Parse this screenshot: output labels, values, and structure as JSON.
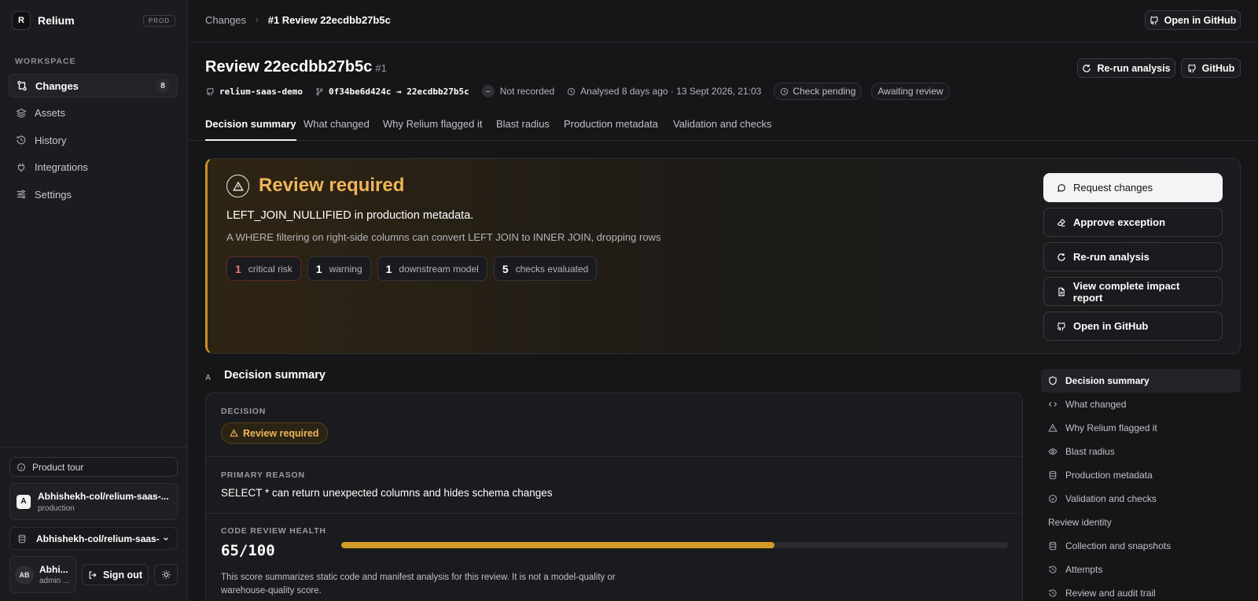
{
  "sidebar": {
    "brand": {
      "logo": "R",
      "name": "Relium",
      "env": "PROD"
    },
    "section_label": "WORKSPACE",
    "nav": [
      {
        "label": "Changes",
        "count": "8",
        "icon": "git-compare-icon"
      },
      {
        "label": "Assets",
        "icon": "layers-icon"
      },
      {
        "label": "History",
        "icon": "history-icon"
      },
      {
        "label": "Integrations",
        "icon": "plug-icon"
      },
      {
        "label": "Settings",
        "icon": "sliders-icon"
      }
    ],
    "product_tour": "Product tour",
    "repo_card": {
      "avatar": "A",
      "name": "Abhishekh-col/relium-saas-...",
      "env": "production"
    },
    "repo_select": "Abhishekh-col/relium-saas-",
    "user": {
      "initials": "AB",
      "name": "Abhi...",
      "role": "admin ..."
    },
    "sign_out": "Sign out"
  },
  "topbar": {
    "breadcrumb_root": "Changes",
    "breadcrumb_current": "#1 Review 22ecdbb27b5c",
    "open_github": "Open in GitHub"
  },
  "header": {
    "title": "Review 22ecdbb27b5c",
    "number": "#1",
    "rerun": "Re-run analysis",
    "github": "GitHub",
    "repo": "relium-saas-demo",
    "commits": "0f34be6d424c → 22ecdbb27b5c",
    "not_recorded_mark": "–",
    "not_recorded": "Not recorded",
    "analysed": "Analysed 8 days ago · 13 Sept 2026, 21:03",
    "check_status": "Check pending",
    "review_status": "Awaiting review"
  },
  "tabs": [
    "Decision summary",
    "What changed",
    "Why Relium flagged it",
    "Blast radius",
    "Production metadata",
    "Validation and checks"
  ],
  "alert": {
    "title": "Review required",
    "rule": "LEFT_JOIN_NULLIFIED in production metadata.",
    "description": "A WHERE filtering on right-side columns can convert LEFT JOIN to INNER JOIN, dropping rows",
    "chips": [
      {
        "count": "1",
        "label": "critical risk"
      },
      {
        "count": "1",
        "label": "warning"
      },
      {
        "count": "1",
        "label": "downstream model"
      },
      {
        "count": "5",
        "label": "checks evaluated"
      }
    ],
    "actions": [
      {
        "label": "Request changes",
        "icon": "message-icon"
      },
      {
        "label": "Approve exception",
        "icon": "eraser-icon"
      },
      {
        "label": "Re-run analysis",
        "icon": "refresh-icon"
      },
      {
        "label": "View complete impact report",
        "icon": "file-icon"
      },
      {
        "label": "Open in GitHub",
        "icon": "github-icon"
      }
    ]
  },
  "decision_summary": {
    "marker": "A",
    "title": "Decision summary",
    "decision_label": "DECISION",
    "decision_value": "Review required",
    "reason_label": "PRIMARY REASON",
    "reason_value": "SELECT * can return unexpected columns and hides schema changes",
    "health_label": "CODE REVIEW HEALTH",
    "health_score": "65/100",
    "health_fraction": 0.65,
    "health_note": "This score summarizes static code and manifest analysis for this review. It is not a model-quality or warehouse-quality score."
  },
  "toc": {
    "items": [
      {
        "label": "Decision summary",
        "icon": "shield-icon"
      },
      {
        "label": "What changed",
        "icon": "code-icon"
      },
      {
        "label": "Why Relium flagged it",
        "icon": "warning-icon"
      },
      {
        "label": "Blast radius",
        "icon": "eye-icon"
      },
      {
        "label": "Production metadata",
        "icon": "database-icon"
      },
      {
        "label": "Validation and checks",
        "icon": "check-circle-icon"
      }
    ],
    "group_label": "Review identity",
    "group_items": [
      {
        "label": "Collection and snapshots",
        "icon": "database-icon"
      },
      {
        "label": "Attempts",
        "icon": "history-icon"
      },
      {
        "label": "Review and audit trail",
        "icon": "history-icon"
      }
    ]
  },
  "colors": {
    "background": "#151618",
    "sidebar": "#1b1c1f",
    "accent_warning": "#f0b45a",
    "progress_fill": "#d29a28",
    "critical": "#f07575"
  }
}
